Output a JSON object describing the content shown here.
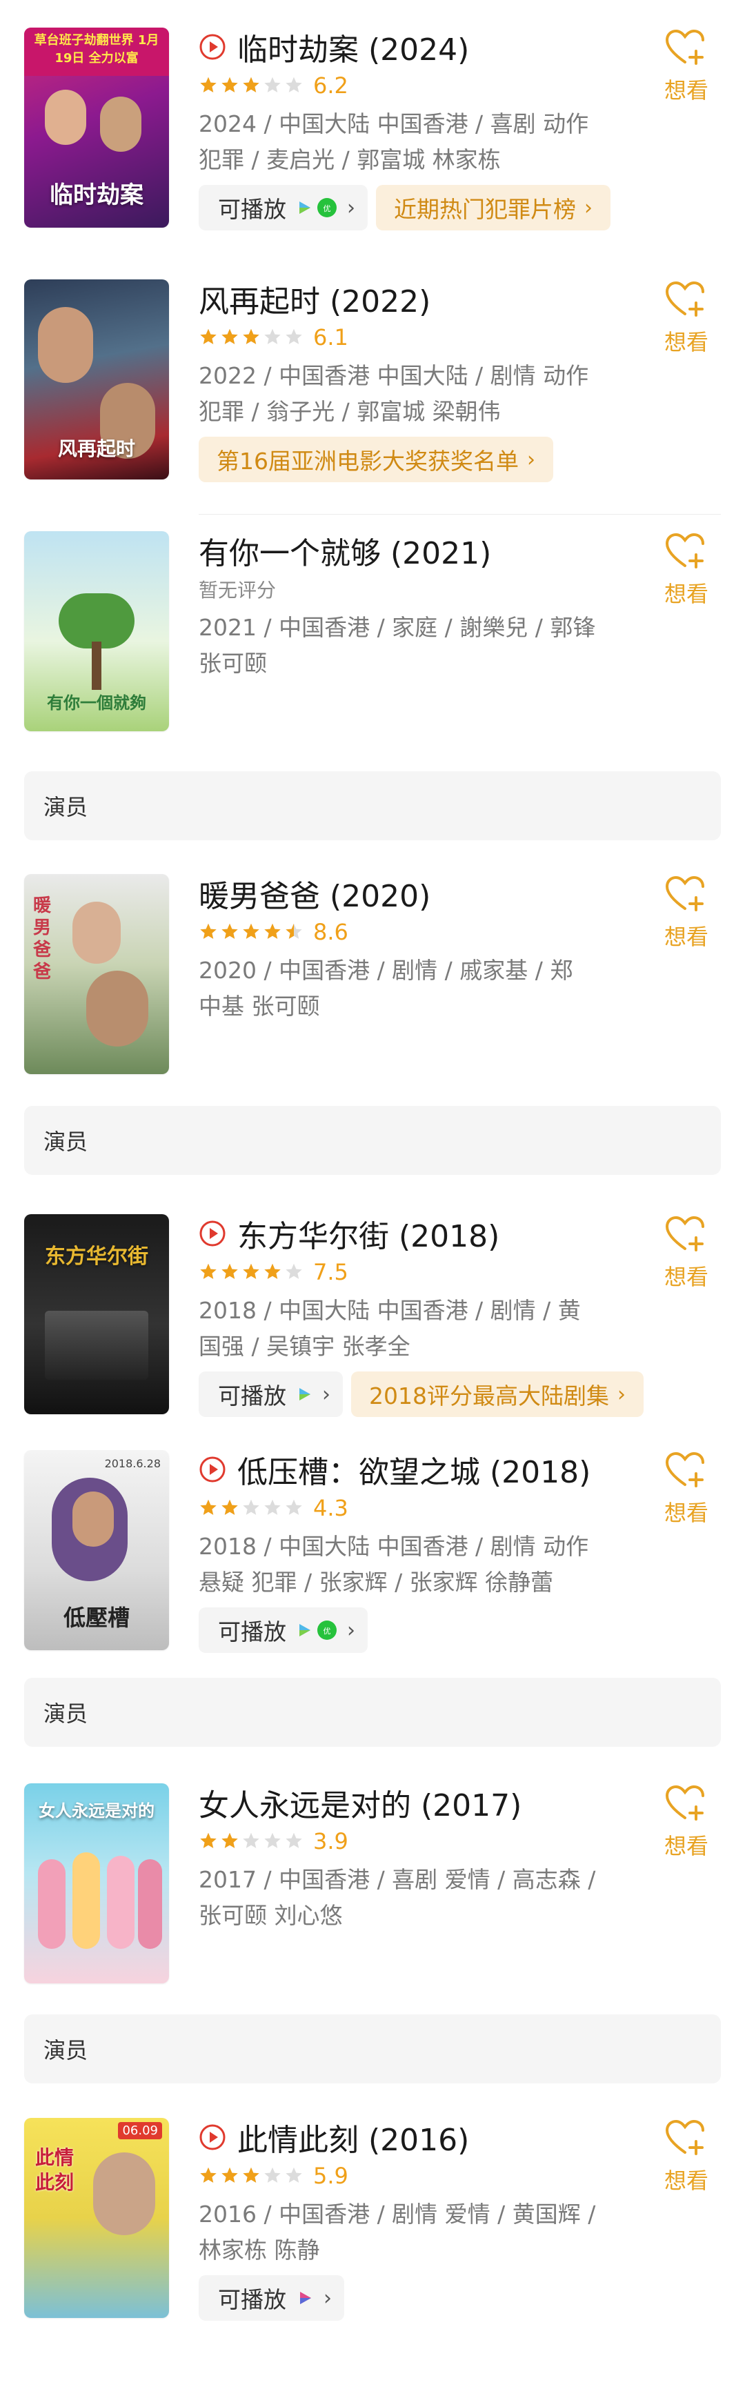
{
  "want_label": "想看",
  "play_label": "可播放",
  "actor_section_label": "演员",
  "colors": {
    "accent": "#f0a019",
    "play_red": "#e03a2e",
    "chip_orange_bg": "#fbefdc"
  },
  "movies": [
    {
      "title": "临时劫案 (2024)",
      "rating": 3,
      "score": "6.2",
      "playable": true,
      "meta_line1": "2024 / 中国大陆 中国香港 / 喜剧 动作",
      "meta_line2": "犯罪 / 麦启光 / 郭富城 林家栋",
      "badge": "近期热门犯罪片榜",
      "platforms": [
        "platform-play-icon",
        "platform-tencent-icon"
      ],
      "poster_text": "临时劫案",
      "poster_banner": "草台班子劫翻世界 1月19日 全力以富"
    },
    {
      "title": "风再起时 (2022)",
      "rating": 3,
      "score": "6.1",
      "playable": false,
      "meta_line1": "2022 / 中国香港 中国大陆 / 剧情 动作",
      "meta_line2": "犯罪 / 翁子光 / 郭富城 梁朝伟",
      "badge": "第16届亚洲电影大奖获奖名单",
      "poster_text": "风再起时"
    },
    {
      "title": "有你一个就够 (2021)",
      "no_rating": "暂无评分",
      "playable": false,
      "meta_line1": "2021 / 中国香港 / 家庭 / 謝樂兒 / 郭锋",
      "meta_line2": "张可颐",
      "poster_text": "有你一個就夠"
    },
    {
      "title": "暖男爸爸 (2020)",
      "rating": 4.5,
      "score": "8.6",
      "playable": false,
      "meta_line1": "2020 / 中国香港 / 剧情 / 戚家基 / 郑",
      "meta_line2": "中基 张可颐",
      "poster_text": "暖男爸爸"
    },
    {
      "title": "东方华尔街 (2018)",
      "rating": 4,
      "score": "7.5",
      "playable": true,
      "meta_line1": "2018 / 中国大陆 中国香港 / 剧情 / 黄",
      "meta_line2": "国强 / 吴镇宇 张孝全",
      "badge": "2018评分最高大陆剧集",
      "platforms": [
        "platform-play-icon"
      ],
      "poster_text": "东方华尔街"
    },
    {
      "title": "低压槽：欲望之城 (2018)",
      "rating": 2,
      "score": "4.3",
      "playable": true,
      "meta_line1": "2018 / 中国大陆 中国香港 / 剧情 动作",
      "meta_line2": "悬疑 犯罪 / 张家辉 / 张家辉 徐静蕾",
      "platforms": [
        "platform-play-icon",
        "platform-tencent-icon"
      ],
      "poster_text": "低壓槽",
      "poster_date": "2018.6.28"
    },
    {
      "title": "女人永远是对的 (2017)",
      "rating": 2,
      "score": "3.9",
      "playable": false,
      "meta_line1": "2017 / 中国香港 / 喜剧 爱情 / 高志森 /",
      "meta_line2": "张可颐 刘心悠",
      "poster_text": "女人永远是对的"
    },
    {
      "title": "此情此刻 (2016)",
      "rating": 3,
      "score": "5.9",
      "playable": true,
      "meta_line1": "2016 / 中国香港 / 剧情 爱情 / 黄国辉 /",
      "meta_line2": "林家栋 陈静",
      "platforms": [
        "platform-play-icon"
      ],
      "poster_text": "此情此刻",
      "poster_date": "06.09"
    }
  ]
}
